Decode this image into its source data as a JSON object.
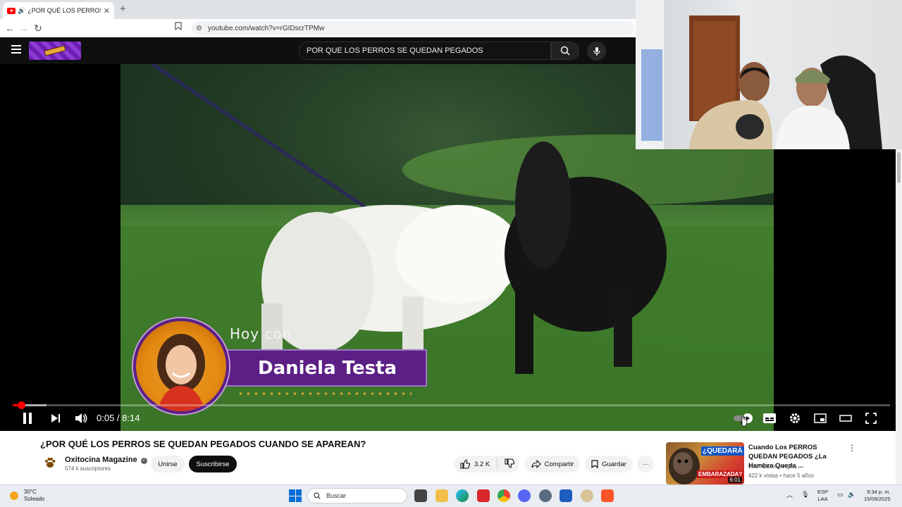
{
  "browser": {
    "tab_title": "¿POR QUÉ LOS PERROS SE QUEDAN PEGADOS",
    "tab_close": "✕",
    "new_tab": "+",
    "url": "youtube.com/watch?v=rGIDscrTPMw",
    "back_icon": "←",
    "forward_icon": "→",
    "reload_icon": "↻"
  },
  "youtube": {
    "search_query": "POR QUE LOS PERROS SE QUEDAN PEGADOS"
  },
  "video": {
    "overlay_intro": "Hoy con",
    "overlay_name": "Daniela Testa",
    "time_current": "0:05",
    "time_total": "8:14",
    "time_display": "0:05 / 8:14",
    "progress_fraction": 0.01
  },
  "info": {
    "title": "¿POR QUÉ LOS PERROS SE QUEDAN PEGADOS CUANDO SE APAREAN?",
    "channel_name": "Oxitocina Magazine",
    "subscribers": "574 k suscriptores",
    "join_label": "Unirse",
    "subscribe_label": "Suscribirse",
    "likes": "3.2 K",
    "share_label": "Compartir",
    "save_label": "Guardar",
    "more_label": "···"
  },
  "recommended": {
    "title": "Cuando Los PERROS QUEDAN PEGADOS ¿La Hembra Queda ...",
    "channel": "Juan Carlos Anglas",
    "meta": "422 k vistas • hace 5 años",
    "duration": "6:01",
    "thumb_text_1": "¿QUEDARÁ",
    "thumb_text_2": "EMBARAZADA?",
    "kebab": "⋮"
  },
  "taskbar": {
    "temperature": "30°C",
    "weather": "Soleado",
    "search_label": "Buscar",
    "lang_1": "ESP",
    "lang_2": "LAA",
    "time": "9:34 p. m.",
    "date": "15/09/2025"
  },
  "colors": {
    "yt_dark": "#0f0f0f",
    "progress_red": "#ff0000",
    "overlay_purple": "#5b1f86"
  }
}
